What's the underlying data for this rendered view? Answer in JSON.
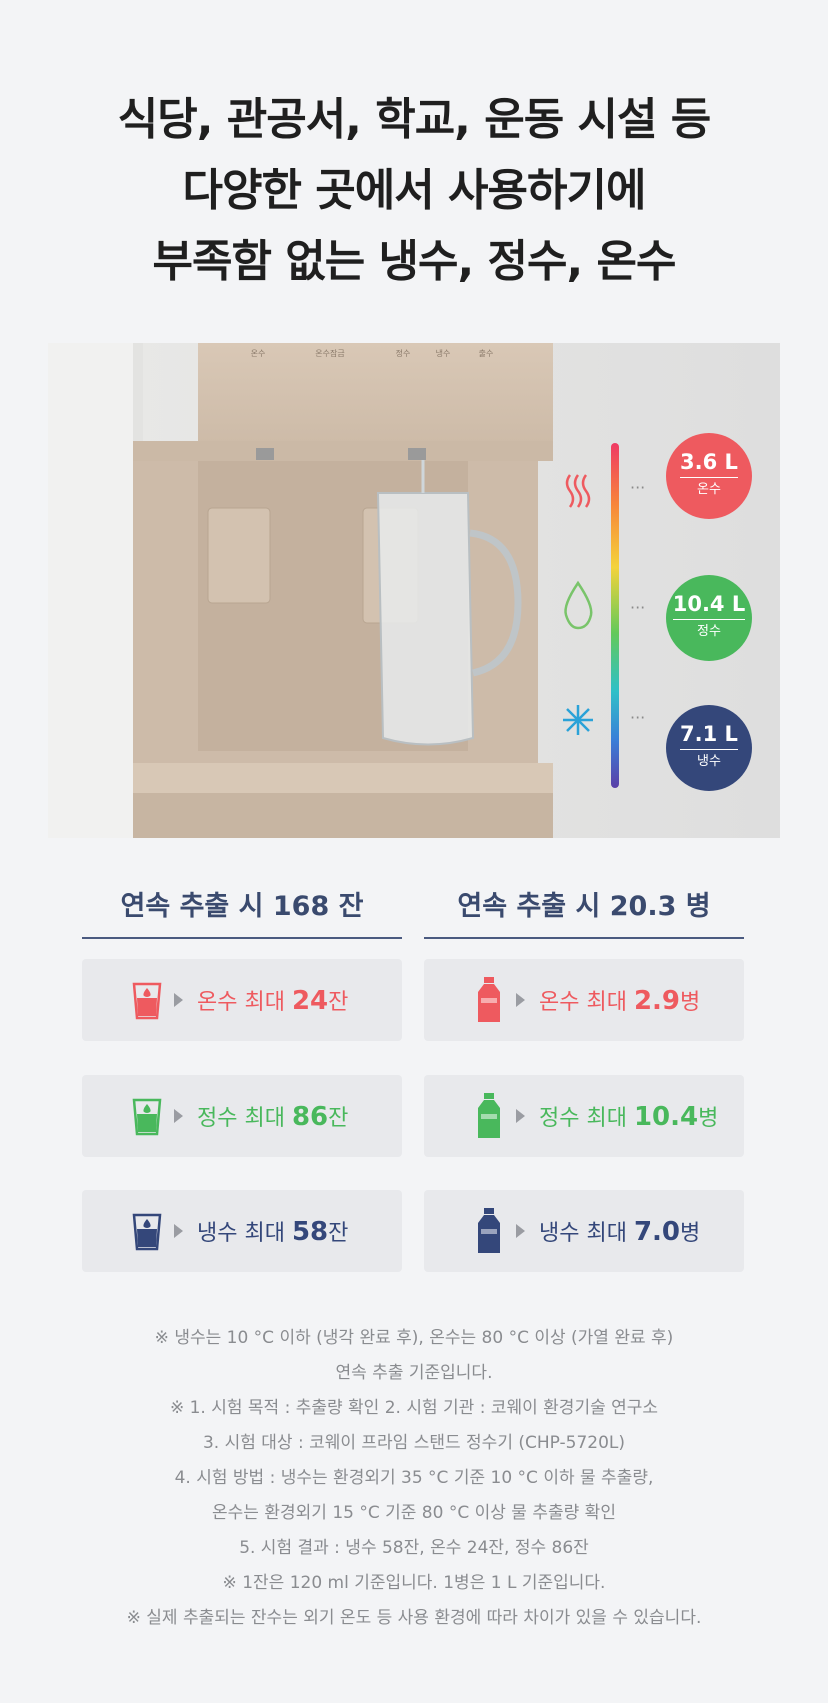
{
  "headline": [
    "식당, 관공서, 학교, 운동 시설 등",
    "다양한 곳에서 사용하기에",
    "부족함 없는 냉수, 정수, 온수"
  ],
  "photo": {
    "panel_labels": [
      "온수",
      "온수잠금",
      "정수",
      "냉수",
      "출수"
    ],
    "gauge": [
      {
        "volume": "3.6 L",
        "kind": "온수",
        "color": "#ee5a5f"
      },
      {
        "volume": "10.4 L",
        "kind": "정수",
        "color": "#49b85c"
      },
      {
        "volume": "7.1 L",
        "kind": "냉수",
        "color": "#34477a"
      }
    ]
  },
  "cups": {
    "title": "연속 추출 시 168 잔",
    "items": [
      {
        "label": "온수 최대 ",
        "value": "24",
        "unit": "잔",
        "color": "#ee5a5f"
      },
      {
        "label": "정수 최대 ",
        "value": "86",
        "unit": "잔",
        "color": "#49b85c"
      },
      {
        "label": "냉수 최대 ",
        "value": "58",
        "unit": "잔",
        "color": "#34477a"
      }
    ]
  },
  "bottles": {
    "title": "연속 추출 시  20.3 병",
    "items": [
      {
        "label": "온수 최대 ",
        "value": "2.9",
        "unit": "병",
        "color": "#ee5a5f"
      },
      {
        "label": "정수 최대 ",
        "value": "10.4",
        "unit": "병",
        "color": "#49b85c"
      },
      {
        "label": "냉수 최대 ",
        "value": "7.0",
        "unit": "병",
        "color": "#34477a"
      }
    ]
  },
  "notes": [
    "※ 냉수는 10 °C 이하 (냉각 완료 후), 온수는 80 °C 이상 (가열 완료 후)",
    "연속 추출 기준입니다.",
    "※ 1. 시험 목적 : 추출량 확인 2. 시험 기관 : 코웨이 환경기술 연구소",
    "3. 시험 대상 : 코웨이 프라임 스탠드 정수기 (CHP-5720L)",
    "4. 시험 방법 : 냉수는 환경외기 35 °C 기준 10 °C 이하 물 추출량,",
    "온수는 환경외기 15 °C 기준 80 °C 이상 물 추출량 확인",
    "5. 시험 결과 : 냉수 58잔, 온수 24잔, 정수 86잔",
    "※ 1잔은 120 ml 기준입니다. 1병은 1 L 기준입니다.",
    "※ 실제 추출되는 잔수는 외기 온도 등 사용 환경에 따라 차이가 있을 수 있습니다."
  ]
}
